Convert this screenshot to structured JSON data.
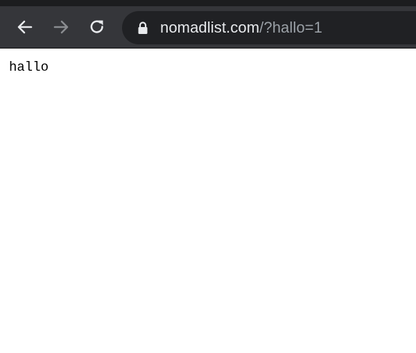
{
  "browser": {
    "toolbar": {
      "back_icon": "arrow-left-icon",
      "forward_icon": "arrow-right-icon",
      "reload_icon": "reload-icon"
    },
    "address_bar": {
      "secure_icon": "lock-icon",
      "host": "nomadlist.com",
      "path": "/?hallo=1"
    },
    "colors": {
      "toolbar_bg": "#35363a",
      "omnibox_bg": "#202124",
      "host_text": "#e8eaed",
      "path_text": "#9aa0a6"
    }
  },
  "page": {
    "body_text": "hallo"
  }
}
